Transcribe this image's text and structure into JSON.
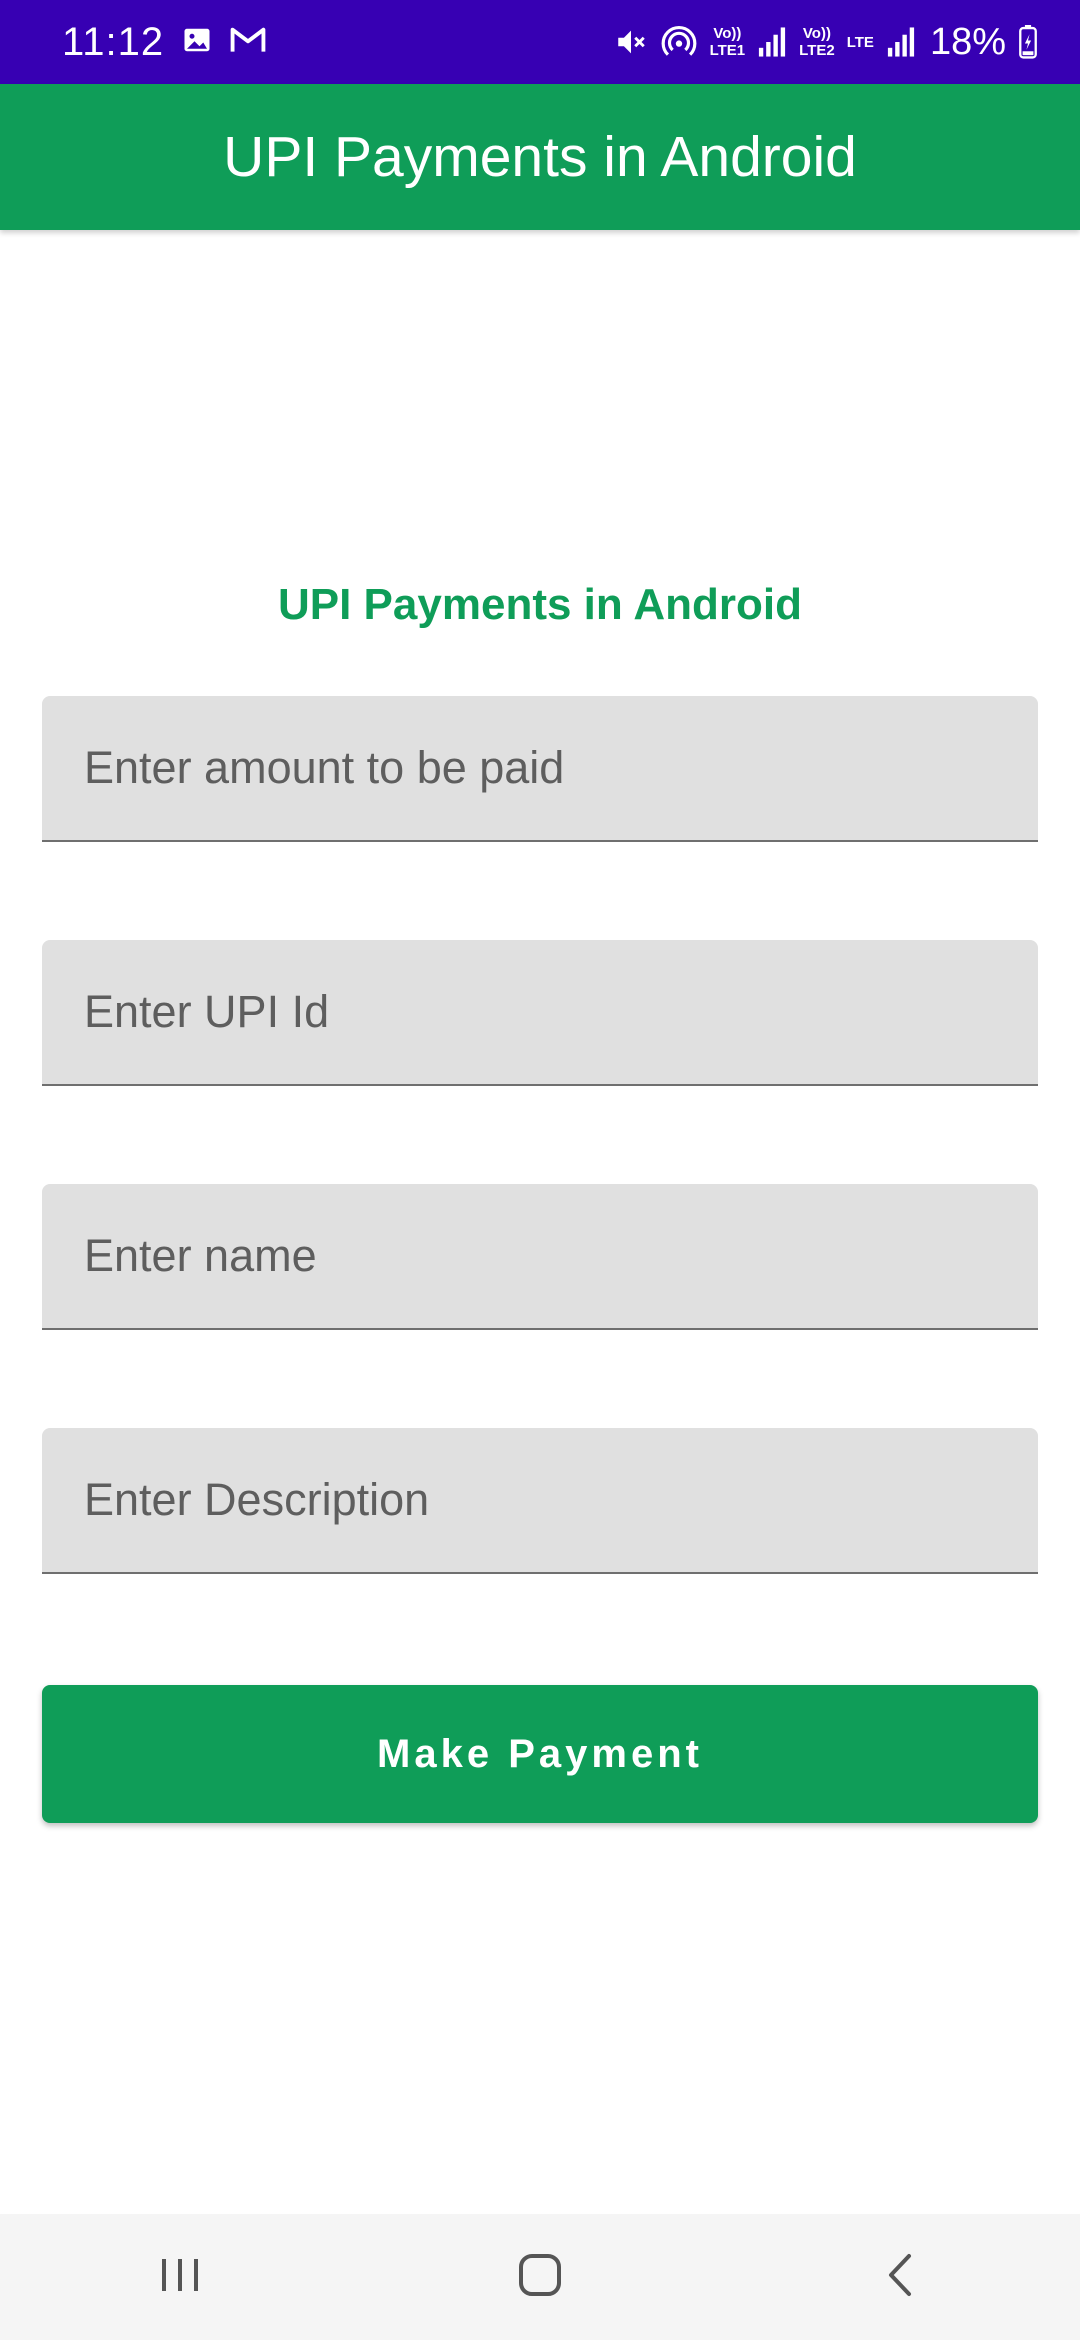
{
  "status_bar": {
    "time": "11:12",
    "sim1_label": "Vo))\nLTE1",
    "sim2_label": "Vo))\nLTE2",
    "lte_label": "LTE",
    "battery": "18%",
    "icons": [
      "image-icon",
      "gmail-icon",
      "mute-icon",
      "hotspot-icon",
      "signal-icon",
      "battery-icon"
    ]
  },
  "app_bar": {
    "title": "UPI Payments in Android"
  },
  "form": {
    "heading": "UPI Payments in Android",
    "amount_placeholder": "Enter amount to be paid",
    "upi_placeholder": "Enter UPI Id",
    "name_placeholder": "Enter name",
    "description_placeholder": "Enter Description",
    "pay_button_label": "Make Payment"
  },
  "nav_bar": {
    "icons": [
      "recents-icon",
      "home-icon",
      "back-icon"
    ]
  },
  "colors": {
    "status_bar": "#3700b3",
    "primary": "#0f9d58",
    "field_bg": "#e0e0e0"
  }
}
